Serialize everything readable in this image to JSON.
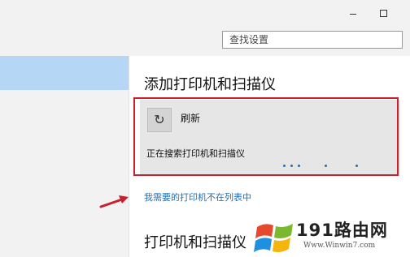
{
  "window": {
    "minimize_icon": "minimize-icon",
    "maximize_icon": "maximize-icon"
  },
  "search": {
    "placeholder": "查找设置"
  },
  "sidebar": {
    "selected_item_color": "#b6d6f5"
  },
  "printers": {
    "heading": "添加打印机和扫描仪",
    "refresh_label": "刷新",
    "refresh_icon": "refresh-icon",
    "searching_text": "正在搜索打印机和扫描仪",
    "not_listed_link": "我需要的打印机不在列表中",
    "section_heading": "打印机和扫描仪"
  },
  "annotation": {
    "frame_color": "#c8202c",
    "arrow_color": "#c8202c"
  },
  "watermark": {
    "text": "191路由网",
    "url": "Www.Winwin7.com"
  }
}
